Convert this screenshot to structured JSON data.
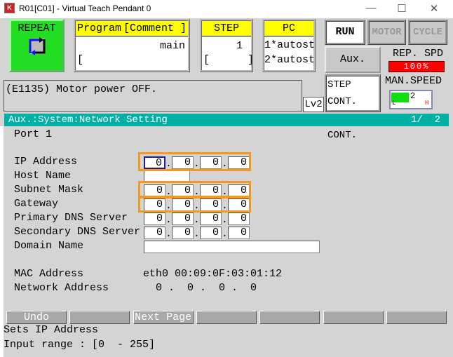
{
  "window": {
    "title": "R01[C01] - Virtual Teach Pendant 0",
    "icon": "kawasaki-k-icon"
  },
  "mode": {
    "label": "REPEAT",
    "icon": "repeat-cycle-icon",
    "color": "#22dd22"
  },
  "program": {
    "header_program": "Program",
    "header_comment": "[Comment ]",
    "name": "main",
    "comment": "[                   ]"
  },
  "step": {
    "header": "STEP",
    "value": "1",
    "comment": "[      ]"
  },
  "pc": {
    "header": "PC",
    "line1": "1*autost",
    "line2": "2*autost"
  },
  "status_buttons": {
    "run": "RUN",
    "motor": "MOTOR",
    "cycle": "CYCLE",
    "aux": "Aux.",
    "step_cont": "STEP CONT.",
    "rep_cont": "REP. CONT."
  },
  "rep_spd": {
    "label": "REP. SPD",
    "value": "100%",
    "color": "#ff0000"
  },
  "man_speed": {
    "label": "MAN.SPEED",
    "value": "2",
    "level_fraction": 0.4,
    "low": "L",
    "high": "H"
  },
  "message": "(E1135) Motor power OFF.",
  "level": "Lv2",
  "screen": {
    "title": "Aux.:System:Network Setting",
    "page": "1/  2",
    "port": "Port 1"
  },
  "fields": {
    "ip_address": {
      "label": "IP Address",
      "octets": [
        "0",
        "0",
        "0",
        "0"
      ]
    },
    "host_name": {
      "label": "Host Name",
      "value": ""
    },
    "subnet_mask": {
      "label": "Subnet Mask",
      "octets": [
        "0",
        "0",
        "0",
        "0"
      ]
    },
    "gateway": {
      "label": "Gateway",
      "octets": [
        "0",
        "0",
        "0",
        "0"
      ]
    },
    "primary_dns": {
      "label": "Primary DNS Server",
      "octets": [
        "0",
        "0",
        "0",
        "0"
      ]
    },
    "secondary_dns": {
      "label": "Secondary DNS Server",
      "octets": [
        "0",
        "0",
        "0",
        "0"
      ]
    },
    "domain_name": {
      "label": "Domain Name",
      "value": ""
    },
    "mac_address": {
      "label": "MAC Address",
      "value": "eth0 00:09:0F:03:01:12"
    },
    "network_address": {
      "label": "Network Address",
      "value": "0 .  0 .  0 .  0"
    }
  },
  "function_keys": [
    "Undo",
    "",
    "Next Page",
    "",
    "",
    "",
    ""
  ],
  "help": {
    "line1": "Sets IP Address",
    "line2": "Input range : [0  - 255]"
  }
}
